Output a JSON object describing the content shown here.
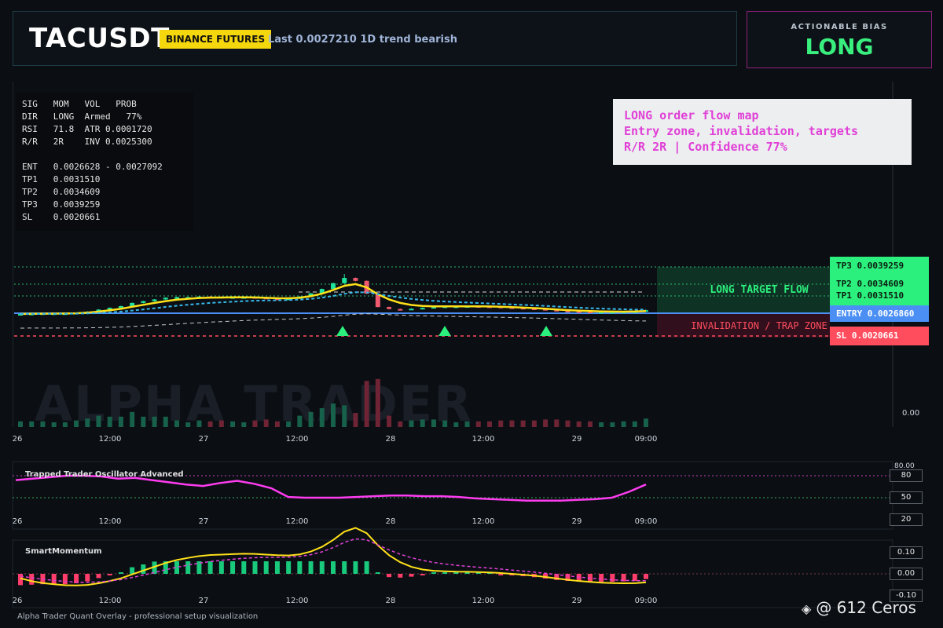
{
  "header": {
    "symbol": "TACUSDT",
    "exchange": "BINANCE FUTURES",
    "last_text": "Last 0.0027210   1D trend bearish"
  },
  "bias": {
    "label": "ACTIONABLE BIAS",
    "value": "LONG"
  },
  "stats": {
    "rows": [
      "SIG   MOM   VOL   PROB",
      "DIR   LONG  Armed   77%",
      "RSI   71.8  ATR 0.0001720",
      "R/R   2R    INV 0.0025300",
      "",
      "ENT   0.0026628 - 0.0027092",
      "TP1   0.0031510",
      "TP2   0.0034609",
      "TP3   0.0039259",
      "SL    0.0020661"
    ]
  },
  "note": {
    "lines": [
      "LONG order flow map",
      "Entry zone, invalidation, targets",
      "R/R 2R | Confidence 77%"
    ]
  },
  "watermark": "ALPHA TRADER",
  "zones": {
    "target_label": "LONG TARGET FLOW",
    "invalidation_label": "INVALIDATION / TRAP ZONE"
  },
  "tags": {
    "tp3": "TP3 0.0039259",
    "tp2": "TP2 0.0034609",
    "tp1": "TP1 0.0031510",
    "entry": "ENTRY 0.0026860",
    "sl": "SL 0.0020661"
  },
  "volume_axis_label": "0.00",
  "indicators": {
    "oscillator": {
      "title": "Trapped Trader Oscillator Advanced",
      "levels": [
        "80.00",
        "80",
        "50",
        "20"
      ]
    },
    "momentum": {
      "title": "SmartMomentum",
      "levels": [
        "0.10",
        "0.00",
        "-0.10"
      ]
    }
  },
  "footer": "Alpha Trader Quant Overlay - professional setup visualization",
  "credit": "@ 612 Ceros",
  "colors": {
    "up": "#1fe39a",
    "down": "#ef5a6f",
    "ema": "#ffe11a",
    "sma": "#37b7e8",
    "tp": "#2cf07d",
    "entry": "#4b8ff5",
    "sl": "#ff4d5e",
    "osc": "#ff3cf0"
  },
  "chart_data": {
    "type": "candlestick",
    "title": "TACUSDT",
    "x_tick_labels": [
      "26",
      "12:00",
      "27",
      "12:00",
      "28",
      "12:00",
      "29",
      "09:00"
    ],
    "levels": {
      "tp3": 0.0039259,
      "tp2": 0.0034609,
      "tp1": 0.003151,
      "entry": 0.002686,
      "entry_zone": [
        0.0026628,
        0.0027092
      ],
      "invalidation": 0.00253,
      "sl": 0.0020661,
      "last": 0.002721
    },
    "close_series_approx": [
      0.00266,
      0.00267,
      0.00268,
      0.00268,
      0.00268,
      0.0027,
      0.00274,
      0.00281,
      0.00287,
      0.00293,
      0.00304,
      0.0031,
      0.00316,
      0.00322,
      0.00324,
      0.00324,
      0.00326,
      0.00325,
      0.00323,
      0.00324,
      0.00324,
      0.00322,
      0.00319,
      0.00318,
      0.00319,
      0.00326,
      0.00337,
      0.00352,
      0.00372,
      0.0039,
      0.0038,
      0.00336,
      0.0029,
      0.00283,
      0.00282,
      0.00284,
      0.00287,
      0.0029,
      0.00292,
      0.00292,
      0.00293,
      0.00292,
      0.00291,
      0.00289,
      0.00287,
      0.00285,
      0.00283,
      0.0028,
      0.00277,
      0.00275,
      0.00274,
      0.00273,
      0.00273,
      0.00273,
      0.00274,
      0.00275,
      0.00279
    ],
    "oscillator_series_approx": [
      74,
      76,
      78,
      80,
      80,
      79,
      76,
      77,
      74,
      71,
      68,
      66,
      70,
      73,
      69,
      63,
      51,
      50,
      50,
      50,
      51,
      52,
      53,
      53,
      52,
      52,
      51,
      49,
      48,
      47,
      46,
      46,
      46,
      47,
      48,
      50,
      58,
      68
    ]
  }
}
